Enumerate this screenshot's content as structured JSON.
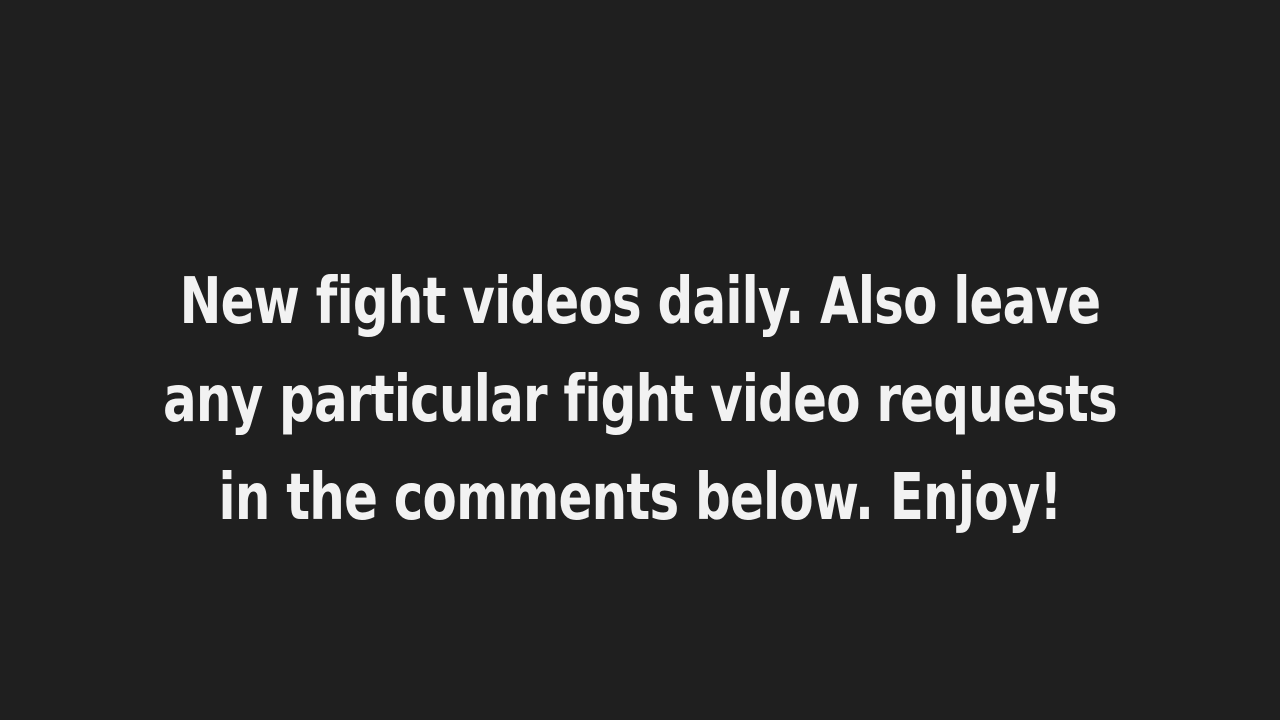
{
  "background_color": "#1f1f1f",
  "text_color": "#f2f2f2",
  "message": {
    "lines": [
      "New fight videos daily. Also leave",
      "any particular fight video requests",
      "in the comments below. Enjoy!"
    ]
  }
}
